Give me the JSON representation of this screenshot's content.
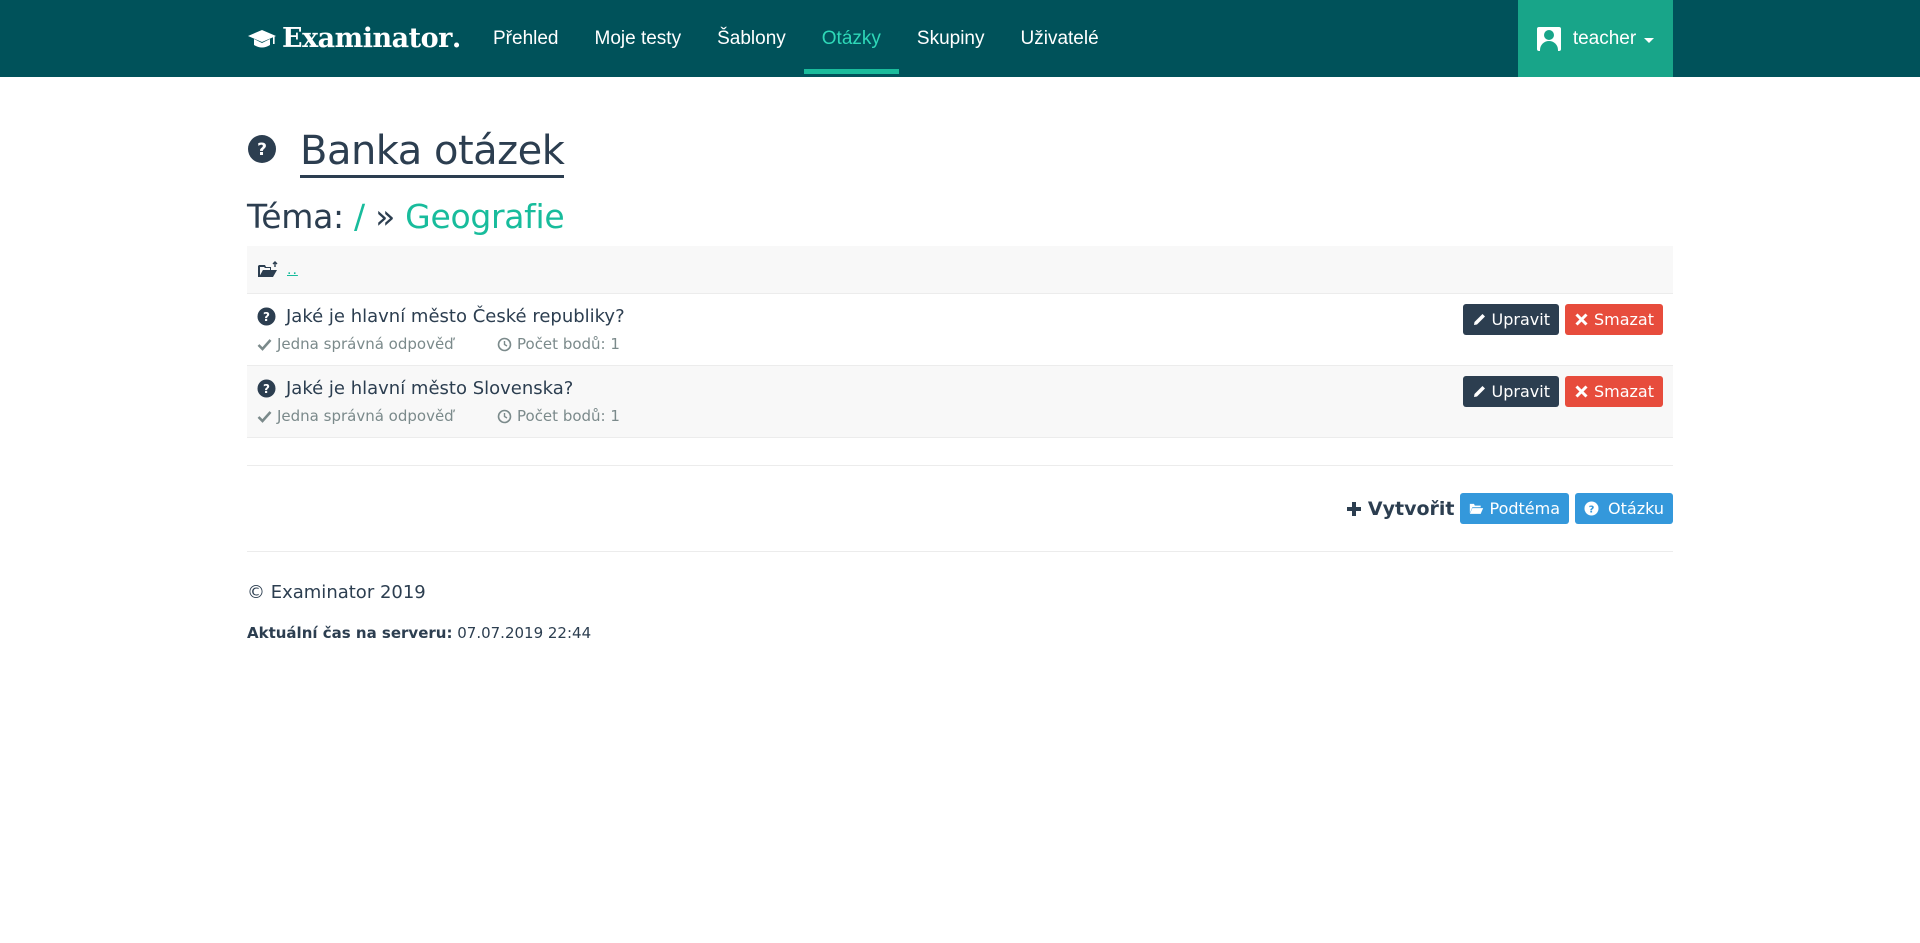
{
  "navbar": {
    "brand": "Examinator",
    "brand_icon": "graduation-cap-icon",
    "links": [
      {
        "label": "Přehled",
        "active": false
      },
      {
        "label": "Moje testy",
        "active": false
      },
      {
        "label": "Šablony",
        "active": false
      },
      {
        "label": "Otázky",
        "active": true
      },
      {
        "label": "Skupiny",
        "active": false
      },
      {
        "label": "Uživatelé",
        "active": false
      }
    ],
    "user": {
      "name": "teacher",
      "icon": "user-icon"
    }
  },
  "page": {
    "title": "Banka otázek",
    "title_icon": "question-circle-icon",
    "breadcrumb": {
      "prefix": "Téma:",
      "root": "/",
      "separator": "»",
      "current": "Geografie"
    }
  },
  "list": {
    "up_link": "..",
    "up_icon": "folder-open-up-icon",
    "questions": [
      {
        "text": "Jaké je hlavní město České republiky?",
        "type": "Jedna správná odpověď",
        "points": "Počet bodů: 1",
        "edit_label": "Upravit",
        "delete_label": "Smazat"
      },
      {
        "text": "Jaké je hlavní město Slovenska?",
        "type": "Jedna správná odpověď",
        "points": "Počet bodů: 1",
        "edit_label": "Upravit",
        "delete_label": "Smazat"
      }
    ]
  },
  "create": {
    "label": "Vytvořit",
    "subtopic_label": "Podtéma",
    "question_label": "Otázku"
  },
  "footer": {
    "copyright": "© Examinator 2019",
    "server_time_label": "Aktuální čas na serveru:",
    "server_time_value": "07.07.2019 22:44"
  },
  "colors": {
    "navbar": "#00525a",
    "accent": "#18bc9c",
    "user_menu": "#18a589",
    "dark_button": "#2c3e50",
    "danger_button": "#e74c3c",
    "info_button": "#3498db"
  }
}
